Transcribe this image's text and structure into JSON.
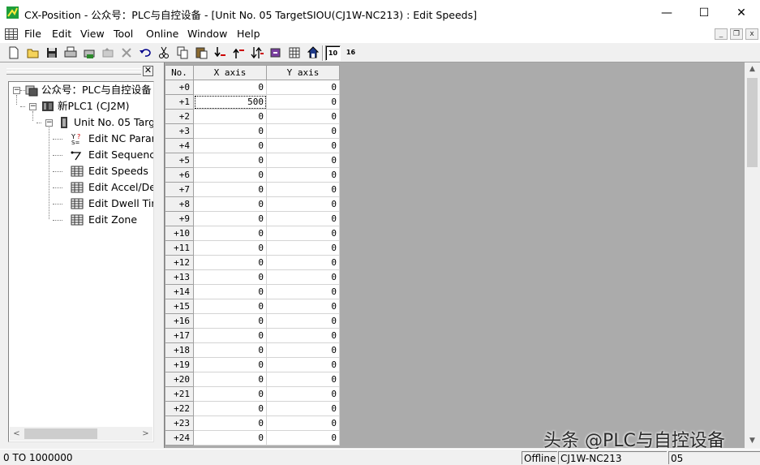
{
  "window": {
    "title": "CX-Position - 公众号：PLC与自控设备 - [Unit No. 05 TargetSIOU(CJ1W-NC213) : Edit Speeds]",
    "minimize": "—",
    "maximize": "☐",
    "close": "✕"
  },
  "menu": {
    "items": [
      "File",
      "Edit",
      "View",
      "Tool",
      "Online",
      "Window",
      "Help"
    ],
    "mdi_minimize": "_",
    "mdi_restore": "❐",
    "mdi_close": "x"
  },
  "toolbar": {
    "icons": [
      "new-icon",
      "open-icon",
      "save-icon",
      "print-icon",
      "print-preview-icon",
      "transfer-icon",
      "delete-icon",
      "cut-icon",
      "undo-icon",
      "copy-icon",
      "paste-icon",
      "download-icon",
      "upload-icon",
      "compare-icon",
      "monitor-icon",
      "grid-icon",
      "network-icon"
    ],
    "radix_10": "10",
    "radix_16": "16"
  },
  "tree": {
    "close": "✕",
    "nodes": [
      {
        "label": "公众号：PLC与自控设备",
        "icon": "project-icon"
      },
      {
        "label": "新PLC1 (CJ2M)",
        "icon": "plc-icon"
      },
      {
        "label": "Unit No. 05 Targ",
        "icon": "unit-icon"
      },
      {
        "label": "Edit NC Parar",
        "icon": "parameter-icon"
      },
      {
        "label": "Edit Sequenc",
        "icon": "sequence-icon"
      },
      {
        "label": "Edit Speeds",
        "icon": "table-icon"
      },
      {
        "label": "Edit Accel/De",
        "icon": "table-icon"
      },
      {
        "label": "Edit Dwell Tir",
        "icon": "table-icon"
      },
      {
        "label": "Edit Zone",
        "icon": "table-icon"
      }
    ]
  },
  "grid": {
    "headers": [
      "No.",
      "X axis",
      "Y axis"
    ],
    "rows": [
      [
        "+0",
        "0",
        "0"
      ],
      [
        "+1",
        "500",
        "0"
      ],
      [
        "+2",
        "0",
        "0"
      ],
      [
        "+3",
        "0",
        "0"
      ],
      [
        "+4",
        "0",
        "0"
      ],
      [
        "+5",
        "0",
        "0"
      ],
      [
        "+6",
        "0",
        "0"
      ],
      [
        "+7",
        "0",
        "0"
      ],
      [
        "+8",
        "0",
        "0"
      ],
      [
        "+9",
        "0",
        "0"
      ],
      [
        "+10",
        "0",
        "0"
      ],
      [
        "+11",
        "0",
        "0"
      ],
      [
        "+12",
        "0",
        "0"
      ],
      [
        "+13",
        "0",
        "0"
      ],
      [
        "+14",
        "0",
        "0"
      ],
      [
        "+15",
        "0",
        "0"
      ],
      [
        "+16",
        "0",
        "0"
      ],
      [
        "+17",
        "0",
        "0"
      ],
      [
        "+18",
        "0",
        "0"
      ],
      [
        "+19",
        "0",
        "0"
      ],
      [
        "+20",
        "0",
        "0"
      ],
      [
        "+21",
        "0",
        "0"
      ],
      [
        "+22",
        "0",
        "0"
      ],
      [
        "+23",
        "0",
        "0"
      ],
      [
        "+24",
        "0",
        "0"
      ]
    ]
  },
  "status": {
    "range": "0 TO 1000000",
    "mode": "Offline",
    "unit_model": "CJ1W-NC213",
    "unit_no": "05"
  },
  "watermark": "头条 @PLC与自控设备"
}
